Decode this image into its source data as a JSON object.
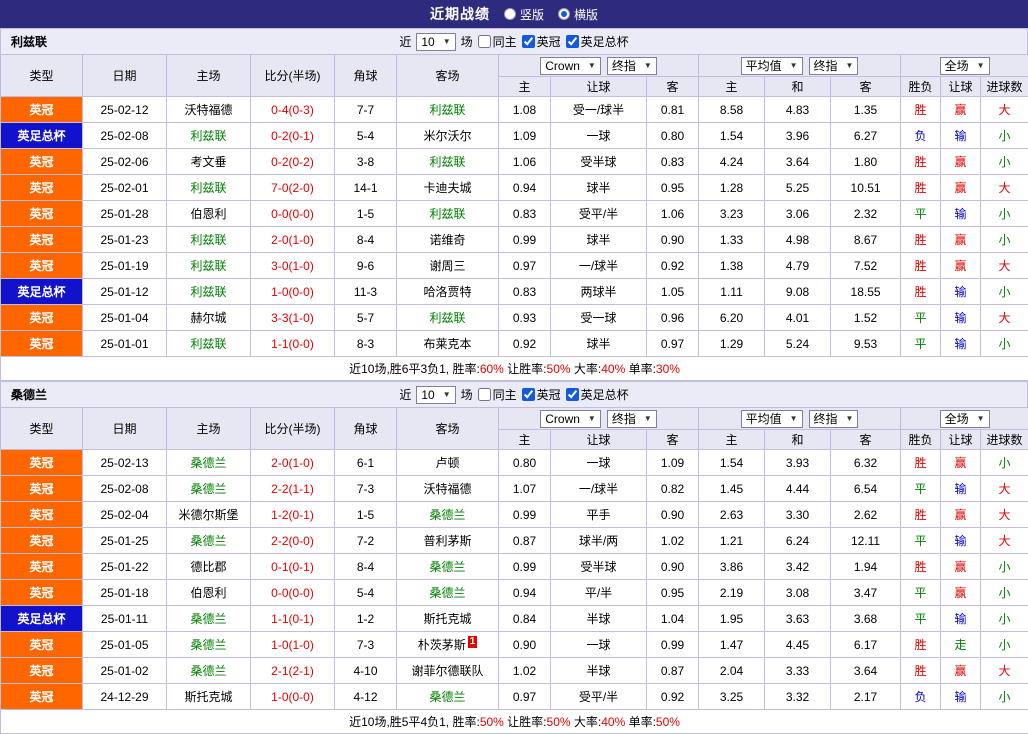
{
  "top_bar": {
    "title": "近期战绩",
    "radios": [
      {
        "label": "竖版",
        "selected": false
      },
      {
        "label": "横版",
        "selected": true
      }
    ]
  },
  "sections": [
    {
      "team": "利兹联",
      "filter": {
        "near_label": "近",
        "count": "10",
        "games_label": "场",
        "checkboxes": [
          {
            "label": "同主",
            "checked": false
          },
          {
            "label": "英冠",
            "checked": true
          },
          {
            "label": "英足总杯",
            "checked": true
          }
        ]
      },
      "header": {
        "cols": [
          "类型",
          "日期",
          "主场",
          "比分(半场)",
          "角球",
          "客场"
        ],
        "odds_group": {
          "selects": [
            "Crown",
            "终指"
          ],
          "cols": [
            "主",
            "让球",
            "客"
          ]
        },
        "avg_group": {
          "selects": [
            "平均值",
            "终指"
          ],
          "cols": [
            "主",
            "和",
            "客"
          ]
        },
        "result_group": {
          "selects": [
            "全场"
          ],
          "cols": [
            "胜负",
            "让球",
            "进球数"
          ]
        }
      },
      "rows": [
        {
          "type": "英冠",
          "date": "25-02-12",
          "home": "沃特福德",
          "score": "0-4(0-3)",
          "corner": "7-7",
          "away": "利兹联",
          "focus": "away",
          "o1": "1.08",
          "hcp": "受一/球半",
          "o2": "0.81",
          "a1": "8.58",
          "a2": "4.83",
          "a3": "1.35",
          "wdl": "胜",
          "hres": "赢",
          "ou": "大"
        },
        {
          "type": "英足总杯",
          "date": "25-02-08",
          "home": "利兹联",
          "score": "0-2(0-1)",
          "corner": "5-4",
          "away": "米尔沃尔",
          "focus": "home",
          "o1": "1.09",
          "hcp": "一球",
          "o2": "0.80",
          "a1": "1.54",
          "a2": "3.96",
          "a3": "6.27",
          "wdl": "负",
          "hres": "输",
          "ou": "小"
        },
        {
          "type": "英冠",
          "date": "25-02-06",
          "home": "考文垂",
          "score": "0-2(0-2)",
          "corner": "3-8",
          "away": "利兹联",
          "focus": "away",
          "o1": "1.06",
          "hcp": "受半球",
          "o2": "0.83",
          "a1": "4.24",
          "a2": "3.64",
          "a3": "1.80",
          "wdl": "胜",
          "hres": "赢",
          "ou": "小"
        },
        {
          "type": "英冠",
          "date": "25-02-01",
          "home": "利兹联",
          "score": "7-0(2-0)",
          "corner": "14-1",
          "away": "卡迪夫城",
          "focus": "home",
          "o1": "0.94",
          "hcp": "球半",
          "o2": "0.95",
          "a1": "1.28",
          "a2": "5.25",
          "a3": "10.51",
          "wdl": "胜",
          "hres": "赢",
          "ou": "大"
        },
        {
          "type": "英冠",
          "date": "25-01-28",
          "home": "伯恩利",
          "score": "0-0(0-0)",
          "corner": "1-5",
          "away": "利兹联",
          "focus": "away",
          "o1": "0.83",
          "hcp": "受平/半",
          "o2": "1.06",
          "a1": "3.23",
          "a2": "3.06",
          "a3": "2.32",
          "wdl": "平",
          "hres": "输",
          "ou": "小"
        },
        {
          "type": "英冠",
          "date": "25-01-23",
          "home": "利兹联",
          "score": "2-0(1-0)",
          "corner": "8-4",
          "away": "诺维奇",
          "focus": "home",
          "o1": "0.99",
          "hcp": "球半",
          "o2": "0.90",
          "a1": "1.33",
          "a2": "4.98",
          "a3": "8.67",
          "wdl": "胜",
          "hres": "赢",
          "ou": "小"
        },
        {
          "type": "英冠",
          "date": "25-01-19",
          "home": "利兹联",
          "score": "3-0(1-0)",
          "corner": "9-6",
          "away": "谢周三",
          "focus": "home",
          "o1": "0.97",
          "hcp": "一/球半",
          "o2": "0.92",
          "a1": "1.38",
          "a2": "4.79",
          "a3": "7.52",
          "wdl": "胜",
          "hres": "赢",
          "ou": "大"
        },
        {
          "type": "英足总杯",
          "date": "25-01-12",
          "home": "利兹联",
          "score": "1-0(0-0)",
          "corner": "11-3",
          "away": "哈洛贾特",
          "focus": "home",
          "o1": "0.83",
          "hcp": "两球半",
          "o2": "1.05",
          "a1": "1.11",
          "a2": "9.08",
          "a3": "18.55",
          "wdl": "胜",
          "hres": "输",
          "ou": "小"
        },
        {
          "type": "英冠",
          "date": "25-01-04",
          "home": "赫尔城",
          "score": "3-3(1-0)",
          "corner": "5-7",
          "away": "利兹联",
          "focus": "away",
          "o1": "0.93",
          "hcp": "受一球",
          "o2": "0.96",
          "a1": "6.20",
          "a2": "4.01",
          "a3": "1.52",
          "wdl": "平",
          "hres": "输",
          "ou": "大"
        },
        {
          "type": "英冠",
          "date": "25-01-01",
          "home": "利兹联",
          "score": "1-1(0-0)",
          "corner": "8-3",
          "away": "布莱克本",
          "focus": "home",
          "o1": "0.92",
          "hcp": "球半",
          "o2": "0.97",
          "a1": "1.29",
          "a2": "5.24",
          "a3": "9.53",
          "wdl": "平",
          "hres": "输",
          "ou": "小"
        }
      ],
      "summary": {
        "prefix": "近10场,胜6平3负1,",
        "parts": [
          {
            "label": "胜率:",
            "value": "60%"
          },
          {
            "label": "让胜率:",
            "value": "50%"
          },
          {
            "label": "大率:",
            "value": "40%"
          },
          {
            "label": "单率:",
            "value": "30%"
          }
        ]
      }
    },
    {
      "team": "桑德兰",
      "filter": {
        "near_label": "近",
        "count": "10",
        "games_label": "场",
        "checkboxes": [
          {
            "label": "同主",
            "checked": false
          },
          {
            "label": "英冠",
            "checked": true
          },
          {
            "label": "英足总杯",
            "checked": true
          }
        ]
      },
      "header": {
        "cols": [
          "类型",
          "日期",
          "主场",
          "比分(半场)",
          "角球",
          "客场"
        ],
        "odds_group": {
          "selects": [
            "Crown",
            "终指"
          ],
          "cols": [
            "主",
            "让球",
            "客"
          ]
        },
        "avg_group": {
          "selects": [
            "平均值",
            "终指"
          ],
          "cols": [
            "主",
            "和",
            "客"
          ]
        },
        "result_group": {
          "selects": [
            "全场"
          ],
          "cols": [
            "胜负",
            "让球",
            "进球数"
          ]
        }
      },
      "rows": [
        {
          "type": "英冠",
          "date": "25-02-13",
          "home": "桑德兰",
          "score": "2-0(1-0)",
          "corner": "6-1",
          "away": "卢顿",
          "focus": "home",
          "o1": "0.80",
          "hcp": "一球",
          "o2": "1.09",
          "a1": "1.54",
          "a2": "3.93",
          "a3": "6.32",
          "wdl": "胜",
          "hres": "赢",
          "ou": "小"
        },
        {
          "type": "英冠",
          "date": "25-02-08",
          "home": "桑德兰",
          "score": "2-2(1-1)",
          "corner": "7-3",
          "away": "沃特福德",
          "focus": "home",
          "o1": "1.07",
          "hcp": "一/球半",
          "o2": "0.82",
          "a1": "1.45",
          "a2": "4.44",
          "a3": "6.54",
          "wdl": "平",
          "hres": "输",
          "ou": "大"
        },
        {
          "type": "英冠",
          "date": "25-02-04",
          "home": "米德尔斯堡",
          "score": "1-2(0-1)",
          "corner": "1-5",
          "away": "桑德兰",
          "focus": "away",
          "o1": "0.99",
          "hcp": "平手",
          "o2": "0.90",
          "a1": "2.63",
          "a2": "3.30",
          "a3": "2.62",
          "wdl": "胜",
          "hres": "赢",
          "ou": "大"
        },
        {
          "type": "英冠",
          "date": "25-01-25",
          "home": "桑德兰",
          "score": "2-2(0-0)",
          "corner": "7-2",
          "away": "普利茅斯",
          "focus": "home",
          "o1": "0.87",
          "hcp": "球半/两",
          "o2": "1.02",
          "a1": "1.21",
          "a2": "6.24",
          "a3": "12.11",
          "wdl": "平",
          "hres": "输",
          "ou": "大"
        },
        {
          "type": "英冠",
          "date": "25-01-22",
          "home": "德比郡",
          "score": "0-1(0-1)",
          "corner": "8-4",
          "away": "桑德兰",
          "focus": "away",
          "o1": "0.99",
          "hcp": "受半球",
          "o2": "0.90",
          "a1": "3.86",
          "a2": "3.42",
          "a3": "1.94",
          "wdl": "胜",
          "hres": "赢",
          "ou": "小"
        },
        {
          "type": "英冠",
          "date": "25-01-18",
          "home": "伯恩利",
          "score": "0-0(0-0)",
          "corner": "5-4",
          "away": "桑德兰",
          "focus": "away",
          "o1": "0.94",
          "hcp": "平/半",
          "o2": "0.95",
          "a1": "2.19",
          "a2": "3.08",
          "a3": "3.47",
          "wdl": "平",
          "hres": "赢",
          "ou": "小"
        },
        {
          "type": "英足总杯",
          "date": "25-01-11",
          "home": "桑德兰",
          "score": "1-1(0-1)",
          "corner": "1-2",
          "away": "斯托克城",
          "focus": "home",
          "o1": "0.84",
          "hcp": "半球",
          "o2": "1.04",
          "a1": "1.95",
          "a2": "3.63",
          "a3": "3.68",
          "wdl": "平",
          "hres": "输",
          "ou": "小"
        },
        {
          "type": "英冠",
          "date": "25-01-05",
          "home": "桑德兰",
          "score": "1-0(1-0)",
          "corner": "7-3",
          "away": "朴茨茅斯",
          "away_badge": "1",
          "focus": "home",
          "o1": "0.90",
          "hcp": "一球",
          "o2": "0.99",
          "a1": "1.47",
          "a2": "4.45",
          "a3": "6.17",
          "wdl": "胜",
          "hres": "走",
          "ou": "小"
        },
        {
          "type": "英冠",
          "date": "25-01-02",
          "home": "桑德兰",
          "score": "2-1(2-1)",
          "corner": "4-10",
          "away": "谢菲尔德联队",
          "focus": "home",
          "o1": "1.02",
          "hcp": "半球",
          "o2": "0.87",
          "a1": "2.04",
          "a2": "3.33",
          "a3": "3.64",
          "wdl": "胜",
          "hres": "赢",
          "ou": "大"
        },
        {
          "type": "英冠",
          "date": "24-12-29",
          "home": "斯托克城",
          "score": "1-0(0-0)",
          "corner": "4-12",
          "away": "桑德兰",
          "focus": "away",
          "o1": "0.97",
          "hcp": "受平/半",
          "o2": "0.92",
          "a1": "3.25",
          "a2": "3.32",
          "a3": "2.17",
          "wdl": "负",
          "hres": "输",
          "ou": "小"
        }
      ],
      "summary": {
        "prefix": "近10场,胜5平4负1,",
        "parts": [
          {
            "label": "胜率:",
            "value": "50%"
          },
          {
            "label": "让胜率:",
            "value": "50%"
          },
          {
            "label": "大率:",
            "value": "40%"
          },
          {
            "label": "单率:",
            "value": "50%"
          }
        ]
      }
    }
  ]
}
